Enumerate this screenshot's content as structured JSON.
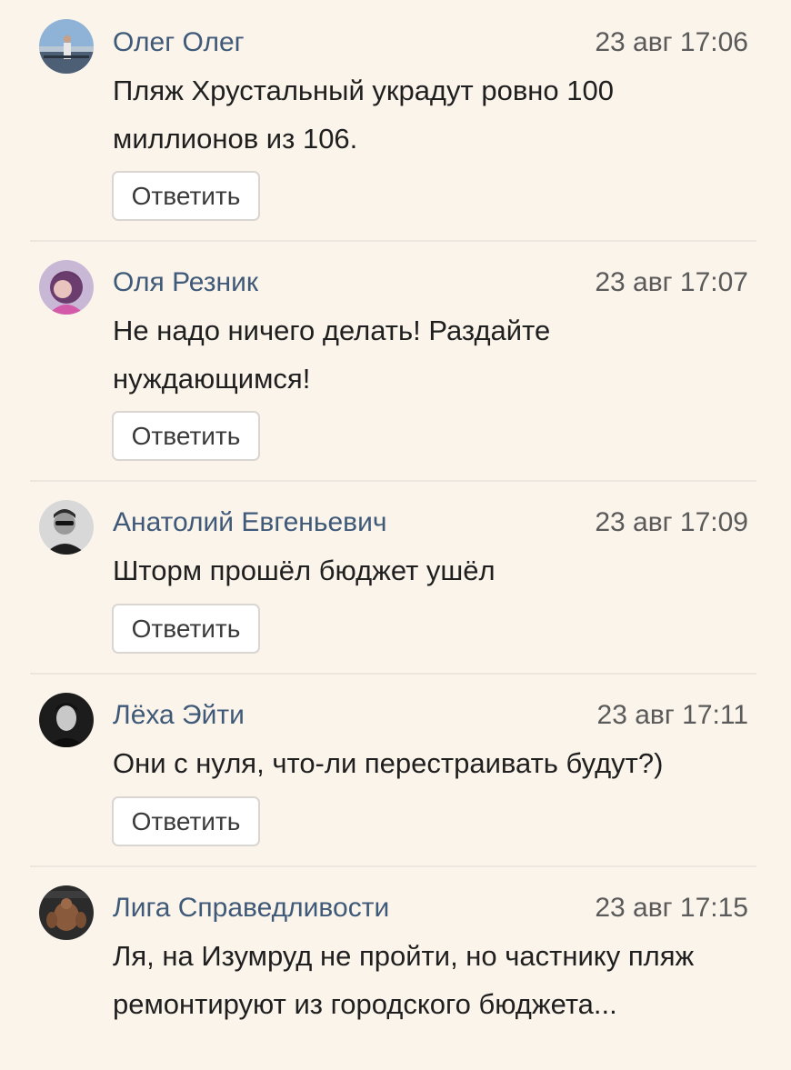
{
  "comments": [
    {
      "author": "Олег Олег",
      "time": "23 авг 17:06",
      "text": "Пляж Хрустальный украдут ровно 100 миллионов из 106.",
      "reply_label": "Ответить",
      "avatar_icon": "avatar-photo-man-bridge"
    },
    {
      "author": "Оля Резник",
      "time": "23 авг 17:07",
      "text": "Не надо ничего делать! Раздайте нуждающимся!",
      "reply_label": "Ответить",
      "avatar_icon": "avatar-photo-woman-pink"
    },
    {
      "author": "Анатолий Евгеньевич",
      "time": "23 авг 17:09",
      "text": "Шторм прошёл бюджет ушёл",
      "reply_label": "Ответить",
      "avatar_icon": "avatar-photo-man-sunglasses"
    },
    {
      "author": "Лёха Эйти",
      "time": "23 авг 17:11",
      "text": "Они с нуля, что-ли перестраивать будут?)",
      "reply_label": "Ответить",
      "avatar_icon": "avatar-photo-man-dark"
    },
    {
      "author": "Лига Справедливости",
      "time": "23 авг 17:15",
      "text": "Ля, на Изумруд не пройти, но частнику пляж ремонтируют из городского бюджета...",
      "reply_label": "Ответить",
      "avatar_icon": "avatar-photo-bodybuilder"
    }
  ],
  "colors": {
    "background": "#fbf4eb",
    "author_link": "#3f5978",
    "timestamp": "#5a5a5a",
    "divider": "#ece6de"
  }
}
